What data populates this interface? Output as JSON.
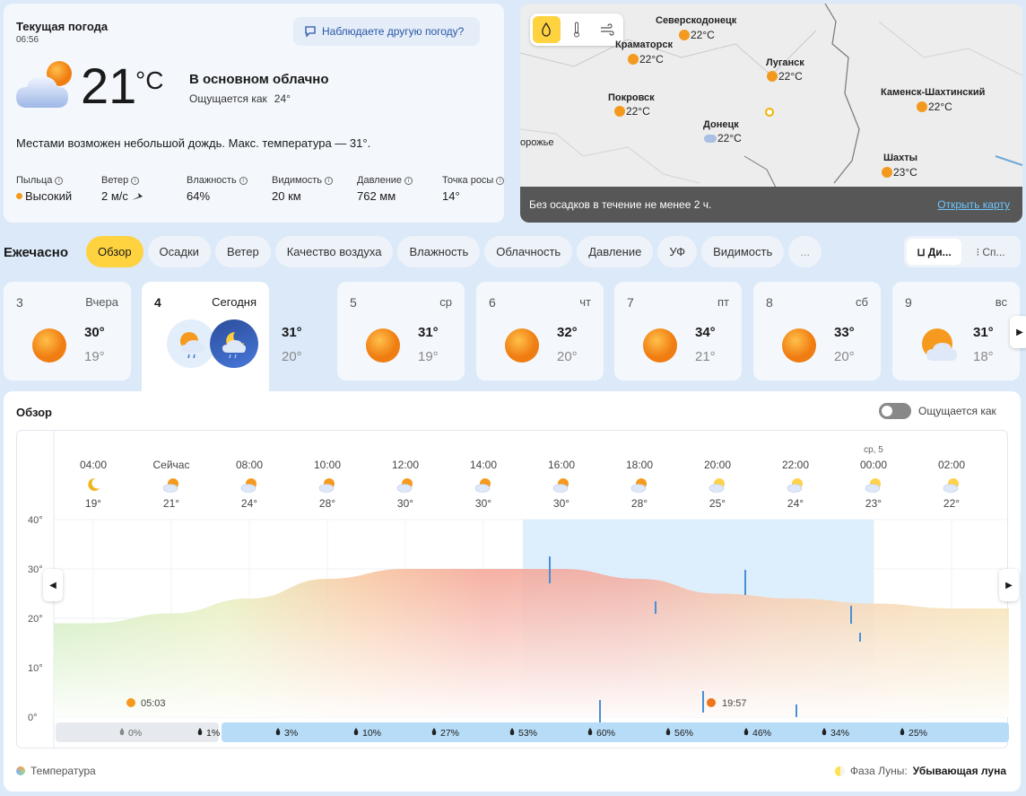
{
  "current": {
    "title": "Текущая погода",
    "time": "06:56",
    "report_label": "Наблюдаете другую погоду?",
    "temp": "21",
    "unit": "°C",
    "condition": "В основном облачно",
    "feels_label": "Ощущается как",
    "feels_value": "24°",
    "description": "Местами возможен небольшой дождь. Макс. температура — 31°.",
    "stats": [
      {
        "label": "Пыльца",
        "value": "Высокий"
      },
      {
        "label": "Ветер",
        "value": "2 м/с"
      },
      {
        "label": "Влажность",
        "value": "64%"
      },
      {
        "label": "Видимость",
        "value": "20 км"
      },
      {
        "label": "Давление",
        "value": "762 мм"
      },
      {
        "label": "Точка росы",
        "value": "14°"
      }
    ]
  },
  "map": {
    "cities": [
      {
        "name": "Северскодонецк",
        "temp": "22°C"
      },
      {
        "name": "Краматорск",
        "temp": "22°C"
      },
      {
        "name": "Луганск",
        "temp": "22°C"
      },
      {
        "name": "Покровск",
        "temp": "22°C"
      },
      {
        "name": "Донецк",
        "temp": "22°C"
      },
      {
        "name": "Каменск-Шахтинский",
        "temp": "22°C"
      },
      {
        "name": "Шахты",
        "temp": "23°C"
      },
      {
        "name": "орожье",
        "temp": ""
      }
    ],
    "footer_text": "Без осадков в течение не менее 2 ч.",
    "open_map": "Открыть карту"
  },
  "hourly": {
    "title": "Ежечасно",
    "tabs": [
      "Обзор",
      "Осадки",
      "Ветер",
      "Качество воздуха",
      "Влажность",
      "Облачность",
      "Давление",
      "УФ",
      "Видимость",
      "..."
    ],
    "view_toggle": [
      "Ди...",
      "Сп..."
    ]
  },
  "days": [
    {
      "num": "3",
      "name": "Вчера",
      "max": "30°",
      "min": "19°",
      "icon": "sun-icon"
    },
    {
      "num": "4",
      "name": "Сегодня",
      "max": "31°",
      "min": "20°",
      "icon": "partly-cloudy-rain-icon"
    },
    {
      "num": "5",
      "name": "ср",
      "max": "31°",
      "min": "19°",
      "icon": "sun-icon"
    },
    {
      "num": "6",
      "name": "чт",
      "max": "32°",
      "min": "20°",
      "icon": "sun-icon"
    },
    {
      "num": "7",
      "name": "пт",
      "max": "34°",
      "min": "21°",
      "icon": "sun-icon"
    },
    {
      "num": "8",
      "name": "сб",
      "max": "33°",
      "min": "20°",
      "icon": "sun-icon"
    },
    {
      "num": "9",
      "name": "вс",
      "max": "31°",
      "min": "18°",
      "icon": "partly-cloudy-icon"
    }
  ],
  "overview": {
    "title": "Обзор",
    "feels_toggle": "Ощущается как",
    "legend": "Температура",
    "moon_label": "Фаза Луны:",
    "moon_value": "Убывающая луна"
  },
  "chart_data": {
    "type": "area",
    "x": [
      "04:00",
      "Сейчас",
      "08:00",
      "10:00",
      "12:00",
      "14:00",
      "16:00",
      "18:00",
      "20:00",
      "22:00",
      "00:00",
      "02:00"
    ],
    "date_marker": "ср, 5",
    "temps": [
      19,
      21,
      24,
      28,
      30,
      30,
      30,
      28,
      25,
      24,
      23,
      22
    ],
    "temp_labels": [
      "19°",
      "21°",
      "24°",
      "28°",
      "30°",
      "30°",
      "30°",
      "28°",
      "25°",
      "24°",
      "23°",
      "22°"
    ],
    "precip_prob": [
      "0%",
      "1%",
      "3%",
      "10%",
      "27%",
      "53%",
      "60%",
      "56%",
      "46%",
      "34%",
      "25%"
    ],
    "ylim": [
      0,
      40
    ],
    "yticks": [
      "40°",
      "30°",
      "20°",
      "10°",
      "0°"
    ],
    "sunrise": "05:03",
    "sunset": "19:57",
    "grid": true
  }
}
